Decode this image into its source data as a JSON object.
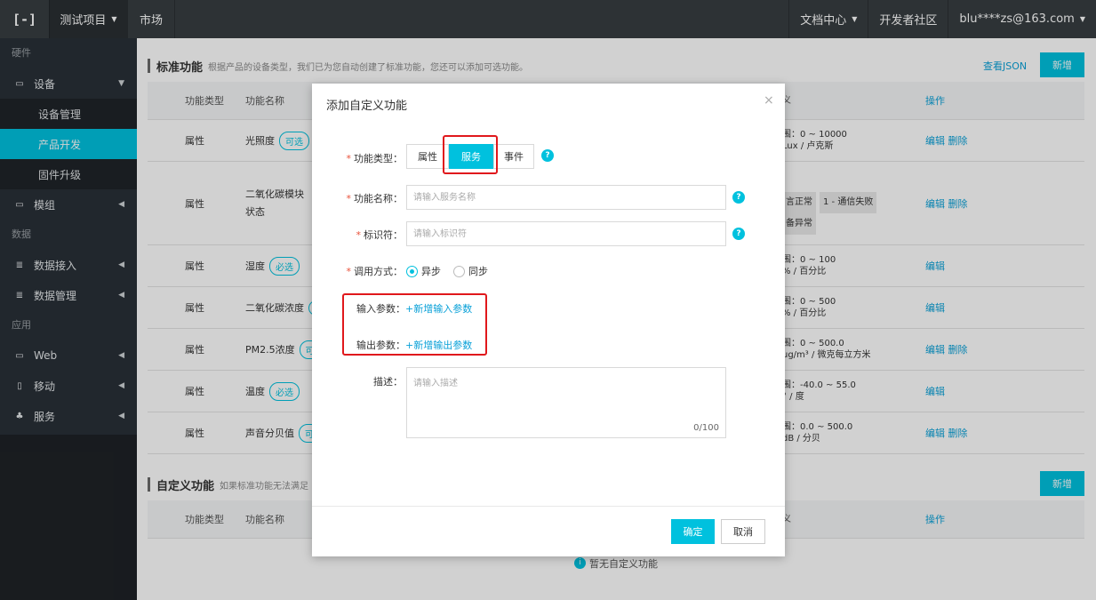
{
  "topbar": {
    "logo": "[-]",
    "project": "测试项目",
    "market": "市场",
    "docs": "文档中心",
    "community": "开发者社区",
    "user": "blu****zs@163.com"
  },
  "sidebar": {
    "section_hardware": "硬件",
    "device": "设备",
    "device_sub": [
      "设备管理",
      "产品开发",
      "固件升级"
    ],
    "module": "模组",
    "section_data": "数据",
    "data_access": "数据接入",
    "data_manage": "数据管理",
    "section_app": "应用",
    "web": "Web",
    "mobile": "移动",
    "service": "服务"
  },
  "main": {
    "std_title": "标准功能",
    "std_desc": "根据产品的设备类型，我们已为您自动创建了标准功能，您还可以添加可选功能。",
    "view_json": "查看JSON",
    "add": "新增",
    "headers": {
      "type": "功能类型",
      "name": "功能名称",
      "define": "义",
      "ops": "操作"
    },
    "rows": [
      {
        "type": "属性",
        "name": "光照度",
        "tag": "可选",
        "define1": "围：0 ~ 10000",
        "define2": "Lux / 卢克斯",
        "edit": "编辑",
        "del": "删除"
      },
      {
        "type": "属性",
        "name": "二氧化碳模块",
        "name2": "状态",
        "define0": ":",
        "pill1": "言正常",
        "pill2": "1 - 通信失败",
        "pill3": "备异常",
        "edit": "编辑",
        "del": "删除"
      },
      {
        "type": "属性",
        "name": "湿度",
        "tag": "必选",
        "define1": "围：0 ~ 100",
        "define2": "% / 百分比",
        "edit": "编辑"
      },
      {
        "type": "属性",
        "name": "二氧化碳浓度",
        "tag": "(",
        "define1": "围：0 ~ 500",
        "define2": "% / 百分比",
        "edit": "编辑"
      },
      {
        "type": "属性",
        "name": "PM2.5浓度",
        "tag": "可",
        "define1": "围：0 ~ 500.0",
        "define2": "ug/m³ / 微克每立方米",
        "edit": "编辑",
        "del": "删除"
      },
      {
        "type": "属性",
        "name": "温度",
        "tag": "必选",
        "define1": "围：-40.0 ~ 55.0",
        "define2": "° / 度",
        "edit": "编辑"
      },
      {
        "type": "属性",
        "name": "声音分贝值",
        "tag": "可",
        "define1": "围：0.0 ~ 500.0",
        "define2": "dB / 分贝",
        "edit": "编辑",
        "del": "删除"
      }
    ],
    "custom_title": "自定义功能",
    "custom_desc": "如果标准功能无法满足",
    "empty": "暂无自定义功能"
  },
  "dialog": {
    "title": "添加自定义功能",
    "close": "×",
    "type_label": "功能类型：",
    "type_options": [
      "属性",
      "服务",
      "事件"
    ],
    "type_selected": "服务",
    "name_label": "功能名称：",
    "name_placeholder": "请输入服务名称",
    "id_label": "标识符：",
    "id_placeholder": "请输入标识符",
    "call_label": "调用方式：",
    "call_options": [
      "异步",
      "同步"
    ],
    "call_selected": "异步",
    "input_label": "输入参数：",
    "input_link": "+新增输入参数",
    "output_label": "输出参数：",
    "output_link": "+新增输出参数",
    "desc_label": "描述：",
    "desc_placeholder": "请输入描述",
    "desc_count": "0/100",
    "ok": "确定",
    "cancel": "取消",
    "help": "?"
  },
  "colors": {
    "accent": "#00c1de",
    "highlight": "#e0181c",
    "sidebar": "#293038",
    "topbar": "#373d41"
  }
}
